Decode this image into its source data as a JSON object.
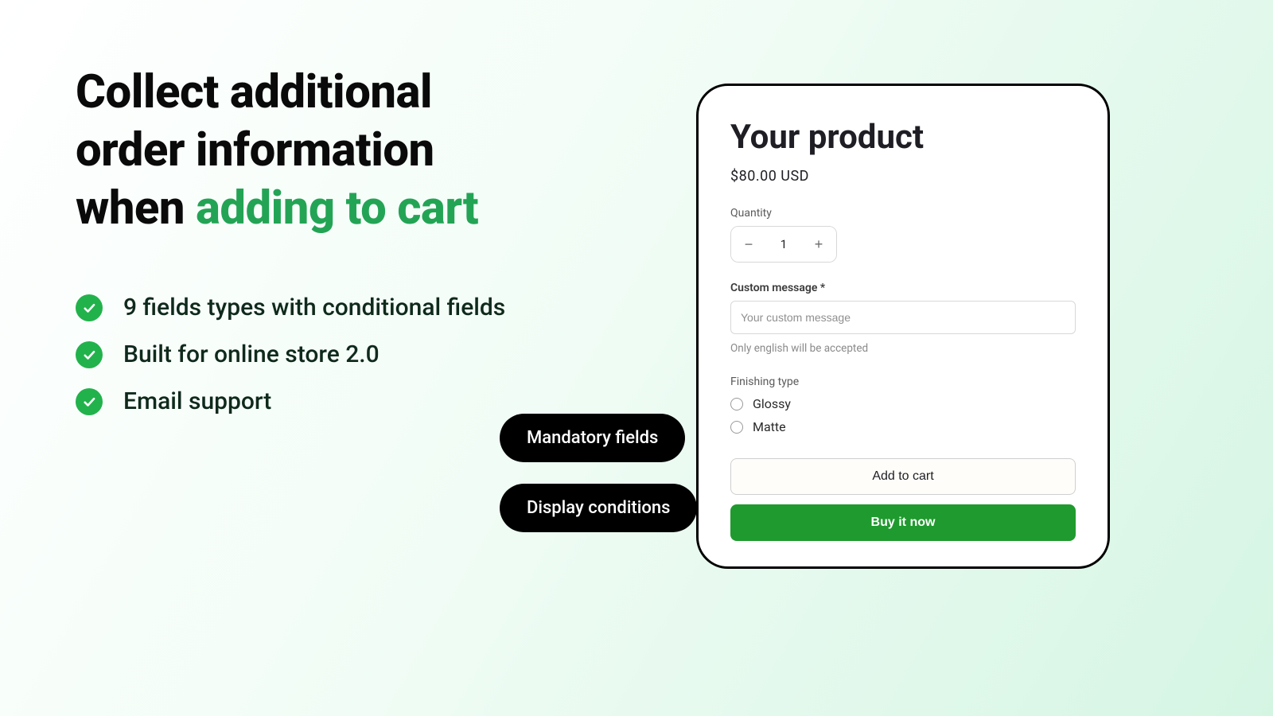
{
  "headline": {
    "line1": "Collect additional",
    "line2": "order information",
    "line3_prefix": "when ",
    "line3_accent": "adding to cart"
  },
  "features": [
    "9 fields types with conditional fields",
    "Built for online store 2.0",
    "Email support"
  ],
  "product": {
    "title": "Your product",
    "price": "$80.00 USD",
    "quantity_label": "Quantity",
    "quantity_value": "1",
    "custom_message_label": "Custom message *",
    "custom_message_placeholder": "Your custom message",
    "custom_message_helper": "Only english will be accepted",
    "finishing_label": "Finishing type",
    "finishing_options": [
      "Glossy",
      "Matte"
    ],
    "add_to_cart": "Add to cart",
    "buy_now": "Buy it now"
  },
  "pills": {
    "mandatory": "Mandatory fields",
    "display": "Display conditions"
  }
}
